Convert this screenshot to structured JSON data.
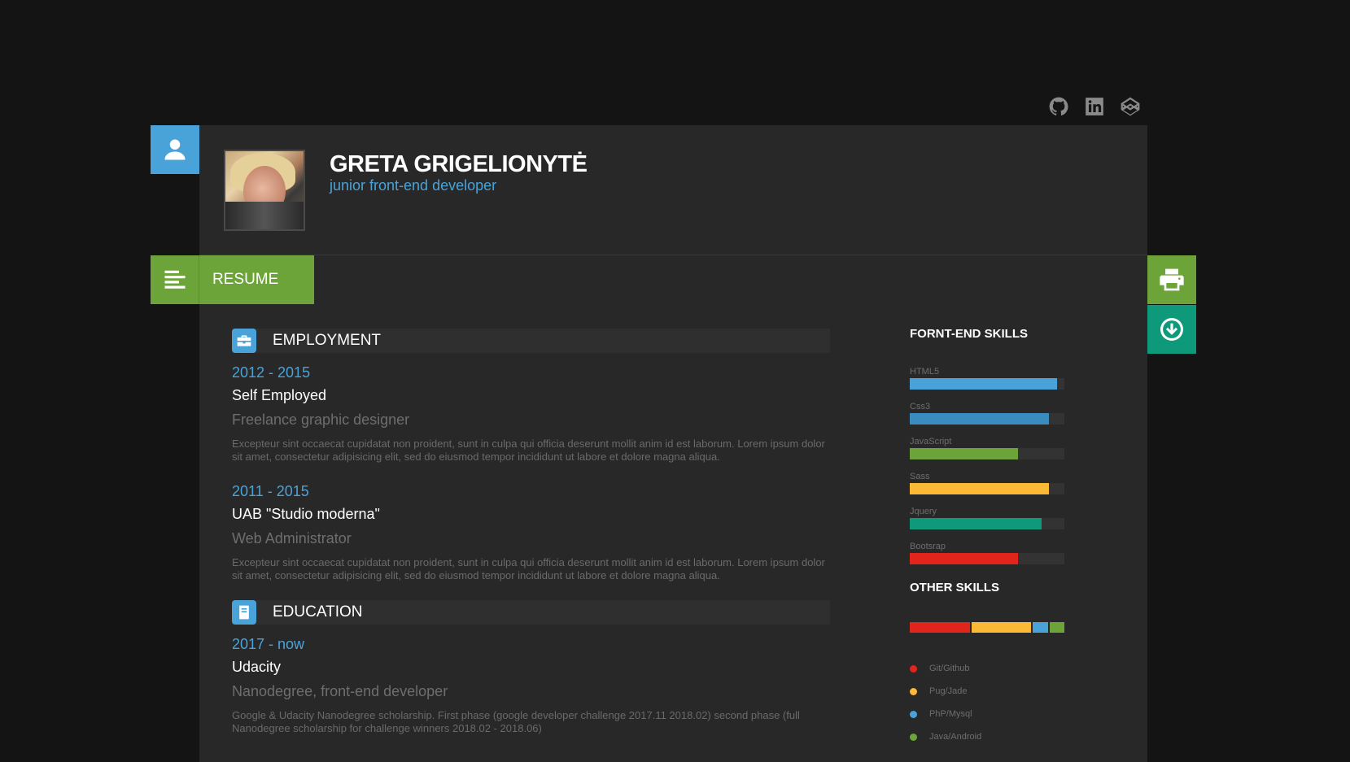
{
  "header": {
    "name": "GRETA GRIGELIONYTĖ",
    "role": "junior front-end developer"
  },
  "social": [
    {
      "icon": "github-icon"
    },
    {
      "icon": "linkedin-icon"
    },
    {
      "icon": "codepen-icon"
    }
  ],
  "nav": {
    "resume_label": "RESUME"
  },
  "sections": {
    "employment": {
      "title": "EMPLOYMENT",
      "entries": [
        {
          "years": "2012 - 2015",
          "org": "Self Employed",
          "position": "Freelance graphic designer",
          "desc": "Excepteur sint occaecat cupidatat non proident, sunt in culpa qui officia deserunt mollit anim id est laborum. Lorem ipsum dolor sit amet, consectetur adipisicing elit, sed do eiusmod tempor incididunt ut labore et dolore magna aliqua."
        },
        {
          "years": "2011 - 2015",
          "org": "UAB \"Studio moderna\"",
          "position": "Web Administrator",
          "desc": "Excepteur sint occaecat cupidatat non proident, sunt in culpa qui officia deserunt mollit anim id est laborum. Lorem ipsum dolor sit amet, consectetur adipisicing elit, sed do eiusmod tempor incididunt ut labore et dolore magna aliqua."
        }
      ]
    },
    "education": {
      "title": "EDUCATION",
      "entries": [
        {
          "years": "2017 - now",
          "org": "Udacity",
          "position": "Nanodegree, front-end developer",
          "desc": "Google & Udacity Nanodegree scholarship. First phase (google developer challenge 2017.11 2018.02) second phase (full Nanodegree scholarship for challenge winners 2018.02 - 2018.06)"
        }
      ]
    }
  },
  "skills": {
    "frontend_title": "FORNT-END SKILLS",
    "frontend": [
      {
        "name": "HTML5",
        "level": 0.95,
        "color": "#4aa3d8"
      },
      {
        "name": "Css3",
        "level": 0.9,
        "color": "#3a8cbf"
      },
      {
        "name": "JavaScript",
        "level": 0.7,
        "color": "#6da43a"
      },
      {
        "name": "Sass",
        "level": 0.9,
        "color": "#fbb936"
      },
      {
        "name": "Jquery",
        "level": 0.85,
        "color": "#0e9a7a"
      },
      {
        "name": "Bootsrap",
        "level": 0.7,
        "color": "#e1251b"
      }
    ],
    "other_title": "OTHER SKILLS",
    "other": [
      {
        "name": "Git/Github",
        "share": 0.4,
        "color": "#e1251b"
      },
      {
        "name": "Pug/Jade",
        "share": 0.4,
        "color": "#fbb936"
      },
      {
        "name": "PhP/Mysql",
        "share": 0.1,
        "color": "#4aa3d8"
      },
      {
        "name": "Java/Android",
        "share": 0.1,
        "color": "#6da43a"
      }
    ]
  }
}
